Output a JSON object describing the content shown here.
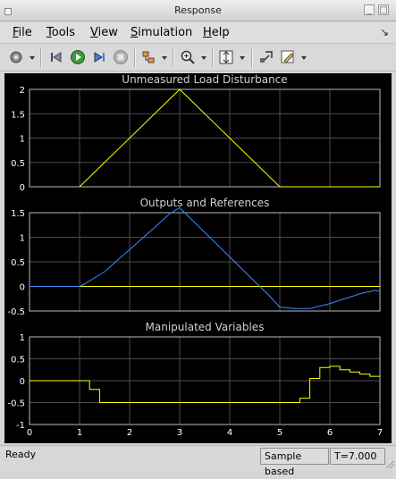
{
  "window": {
    "title": "Response"
  },
  "menu": [
    {
      "label": "File"
    },
    {
      "label": "Tools"
    },
    {
      "label": "View"
    },
    {
      "label": "Simulation"
    },
    {
      "label": "Help"
    }
  ],
  "toolbar": {
    "icons": [
      "settings-icon",
      "rewind-icon",
      "run-icon",
      "step-forward-icon",
      "stop-icon",
      "data-cursor-icon",
      "zoom-in-icon",
      "autoscale-icon",
      "dock-icon",
      "edit-icon"
    ]
  },
  "status": {
    "ready": "Ready",
    "mode": "Sample based",
    "time": "T=7.000"
  },
  "colors": {
    "background": "#000000",
    "grid": "#4d4d4d",
    "axis_text": "#ffffff",
    "title_text": "#d0d0d0",
    "yellow": "#ffff00",
    "blue": "#3b8cff"
  },
  "chart_data": [
    {
      "type": "line",
      "title": "Unmeasured Load Disturbance",
      "xlim": [
        0,
        7
      ],
      "ylim": [
        0,
        2
      ],
      "xticks": [
        "0",
        "1",
        "2",
        "3",
        "4",
        "5",
        "6",
        "7"
      ],
      "yticks": [
        "0",
        "0.5",
        "1",
        "1.5",
        "2"
      ],
      "grid": true,
      "series": [
        {
          "color": "#ffff00",
          "step": false,
          "x": [
            1,
            3,
            5,
            7
          ],
          "y": [
            0,
            2,
            0,
            0
          ]
        }
      ]
    },
    {
      "type": "line",
      "title": "Outputs and References",
      "xlim": [
        0,
        7
      ],
      "ylim": [
        -0.5,
        1.5
      ],
      "xticks": [
        "0",
        "1",
        "2",
        "3",
        "4",
        "5",
        "6",
        "7"
      ],
      "yticks": [
        "-0.5",
        "0",
        "0.5",
        "1",
        "1.5"
      ],
      "grid": true,
      "series": [
        {
          "color": "#ffff00",
          "step": false,
          "x": [
            0,
            7
          ],
          "y": [
            0,
            0
          ]
        },
        {
          "color": "#3b8cff",
          "step": false,
          "x": [
            0,
            1,
            1.1,
            1.5,
            2,
            2.5,
            2.8,
            3,
            3.5,
            4,
            4.5,
            4.8,
            5.0,
            5.3,
            5.6,
            5.8,
            6.0,
            6.3,
            6.6,
            6.9,
            7.0
          ],
          "y": [
            0,
            0,
            0.05,
            0.3,
            0.75,
            1.2,
            1.48,
            1.6,
            1.1,
            0.6,
            0.1,
            -0.2,
            -0.42,
            -0.45,
            -0.45,
            -0.4,
            -0.35,
            -0.25,
            -0.15,
            -0.08,
            -0.1
          ]
        }
      ]
    },
    {
      "type": "line",
      "title": "Manipulated Variables",
      "xlim": [
        0,
        7
      ],
      "ylim": [
        -1,
        1
      ],
      "xticks": [
        "0",
        "1",
        "2",
        "3",
        "4",
        "5",
        "6",
        "7"
      ],
      "yticks": [
        "-1",
        "-0.5",
        "0",
        "0.5",
        "1"
      ],
      "grid": true,
      "series": [
        {
          "color": "#ffff00",
          "step": true,
          "x": [
            0,
            1.2,
            1.4,
            5.4,
            5.6,
            5.8,
            6.0,
            6.2,
            6.4,
            6.6,
            6.8,
            7.0
          ],
          "y": [
            0,
            -0.2,
            -0.5,
            -0.4,
            0.05,
            0.3,
            0.33,
            0.25,
            0.2,
            0.15,
            0.1,
            0.1
          ]
        }
      ]
    }
  ]
}
